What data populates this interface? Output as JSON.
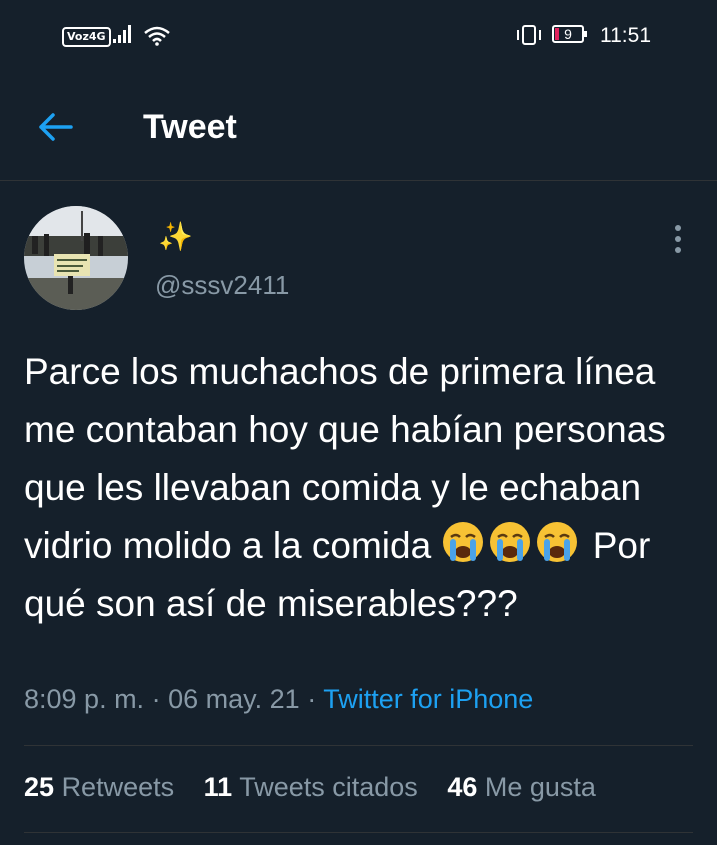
{
  "status_bar": {
    "network_badge": "Voz4G",
    "battery_level": "9",
    "time": "11:51"
  },
  "header": {
    "title": "Tweet"
  },
  "tweet": {
    "display_name": "✨",
    "handle": "@sssv2411",
    "text_before_emoji": "Parce los muchachos de primera línea me contaban hoy que habían personas que les llevaban comida y le echaban vidrio molido a la comida ",
    "emoji_count": 3,
    "text_after_emoji": " Por qué son así de miserables???",
    "time": "8:09 p. m.",
    "separator": "·",
    "date": "06 may. 21",
    "source": "Twitter for iPhone"
  },
  "stats": {
    "retweets_count": "25",
    "retweets_label": "Retweets",
    "quotes_count": "11",
    "quotes_label": "Tweets citados",
    "likes_count": "46",
    "likes_label": "Me gusta"
  },
  "colors": {
    "background": "#15202b",
    "accent": "#1da1f2",
    "secondary_text": "#8899a6",
    "divider": "#2f3336"
  },
  "icons": [
    "back-arrow-icon",
    "more-vertical-icon",
    "signal-icon",
    "wifi-icon",
    "vibrate-icon",
    "battery-icon",
    "crying-face-icon"
  ]
}
